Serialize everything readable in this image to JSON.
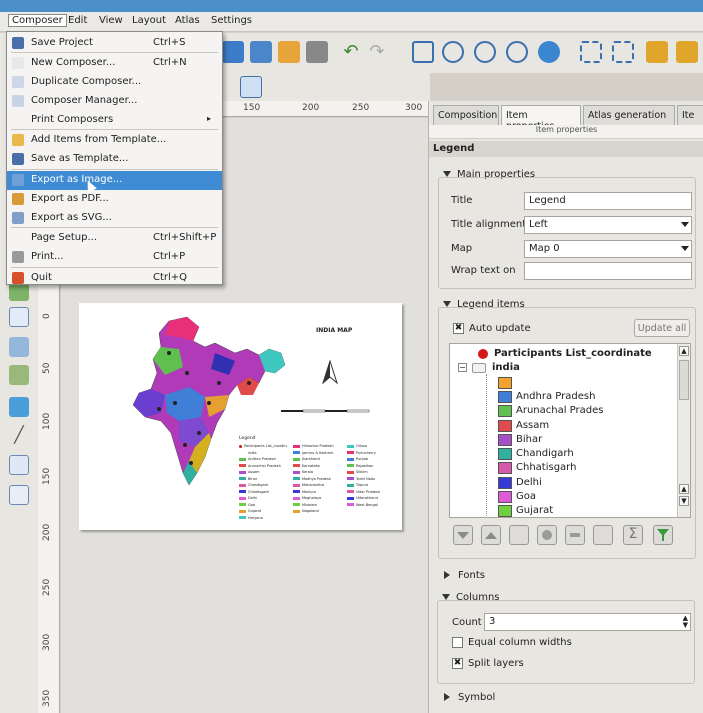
{
  "menubar": {
    "items": [
      "Composer",
      "Edit",
      "View",
      "Layout",
      "Atlas",
      "Settings"
    ]
  },
  "composer_menu": {
    "items": [
      {
        "label": "Save Project",
        "shortcut": "Ctrl+S",
        "icon": "save-icon"
      },
      {
        "label": "New Composer...",
        "shortcut": "Ctrl+N",
        "icon": "new-composer-icon"
      },
      {
        "label": "Duplicate Composer...",
        "shortcut": "",
        "icon": "duplicate-icon"
      },
      {
        "label": "Composer Manager...",
        "shortcut": "",
        "icon": "composer-manager-icon"
      },
      {
        "label": "Print Composers",
        "shortcut": "",
        "icon": "",
        "submenu_arrow": "▸"
      },
      {
        "label": "Add Items from Template...",
        "shortcut": "",
        "icon": "folder-icon"
      },
      {
        "label": "Save as Template...",
        "shortcut": "",
        "icon": "save-template-icon"
      },
      {
        "label": "Export as Image...",
        "shortcut": "",
        "icon": "export-image-icon",
        "highlighted": true
      },
      {
        "label": "Export as PDF...",
        "shortcut": "",
        "icon": "export-pdf-icon"
      },
      {
        "label": "Export as SVG...",
        "shortcut": "",
        "icon": "export-svg-icon"
      },
      {
        "label": "Page Setup...",
        "shortcut": "Ctrl+Shift+P",
        "icon": ""
      },
      {
        "label": "Print...",
        "shortcut": "Ctrl+P",
        "icon": "print-icon"
      },
      {
        "label": "Quit",
        "shortcut": "Ctrl+Q",
        "icon": "quit-icon"
      }
    ]
  },
  "ruler": {
    "h_ticks": [
      "150",
      "200",
      "250",
      "300"
    ],
    "v_ticks": [
      "0",
      "50",
      "100",
      "150",
      "200",
      "250",
      "300",
      "350"
    ]
  },
  "map_page": {
    "title": "INDIA MAP",
    "legend_heading": "Legend",
    "legend_entries": [
      "Participants List_coordinate",
      "india",
      "Andhra Pradesh",
      "Arunachal Pradesh",
      "Assam",
      "Bihar",
      "Chandigarh",
      "Chhatisgarh",
      "Delhi",
      "Goa",
      "Gujarat",
      "Haryana",
      "Himachal Pradesh",
      "Jammu & Kashmir",
      "Jharkhand",
      "Karnataka",
      "Kerala",
      "Madhya Pradesh",
      "Maharashtra",
      "Manipur",
      "Meghalaya",
      "Mizoram",
      "Nagaland",
      "Orissa",
      "Puducherry",
      "Punjab",
      "Rajasthan",
      "Sikkim",
      "Tamil Nadu",
      "Tripura",
      "Uttar Pradesh",
      "Uttarakhand",
      "West Bengal"
    ]
  },
  "right_panel": {
    "tabs": [
      "Composition",
      "Item properties",
      "Atlas generation",
      "Ite"
    ],
    "subheader": "Item properties",
    "section": "Legend",
    "main_properties": {
      "heading": "Main properties",
      "title_label": "Title",
      "title_value": "Legend",
      "title_alignment_label": "Title alignment",
      "title_alignment_value": "Left",
      "map_label": "Map",
      "map_value": "Map 0",
      "wrap_label": "Wrap text on",
      "wrap_value": ""
    },
    "legend_items": {
      "heading": "Legend items",
      "auto_update_label": "Auto update",
      "update_all_label": "Update all",
      "tree": [
        {
          "label": "Participants List_coordinate",
          "bold": true
        },
        {
          "label": "india",
          "bold": true
        },
        {
          "label": "",
          "color": "#f4a22c"
        },
        {
          "label": "Andhra Pradesh",
          "color": "#3f7fd8"
        },
        {
          "label": "Arunachal Prades",
          "color": "#5fbf4f"
        },
        {
          "label": "Assam",
          "color": "#e14a4a"
        },
        {
          "label": "Bihar",
          "color": "#a54fc8"
        },
        {
          "label": "Chandigarh",
          "color": "#2fb0a0"
        },
        {
          "label": "Chhatisgarh",
          "color": "#d65aa8"
        },
        {
          "label": "Delhi",
          "color": "#3838d8"
        },
        {
          "label": "Goa",
          "color": "#e05ad8"
        },
        {
          "label": "Gujarat",
          "color": "#6fcf3f"
        }
      ]
    },
    "fonts_heading": "Fonts",
    "columns": {
      "heading": "Columns",
      "count_label": "Count",
      "count_value": "3",
      "equal_widths_label": "Equal column widths",
      "split_layers_label": "Split layers"
    },
    "symbol_heading": "Symbol"
  }
}
